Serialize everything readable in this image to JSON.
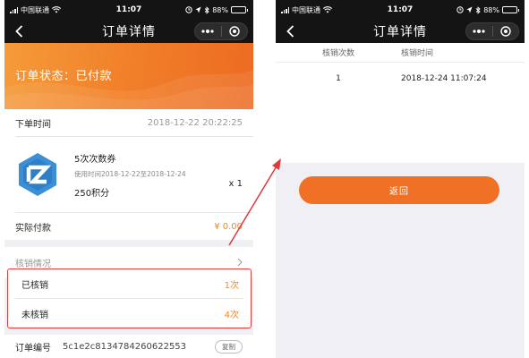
{
  "status_bar": {
    "carrier": "中国联通",
    "time": "11:07",
    "battery": "88%",
    "battery_level": 0.88
  },
  "left": {
    "nav_title": "订单详情",
    "order_status": "订单状态：已付款",
    "order_time_label": "下单时间",
    "order_time_value": "2018-12-22 20:22:25",
    "product": {
      "name": "5次次数券",
      "period": "使用时间2018-12-22至2018-12-24",
      "points": "250积分",
      "qty": "x 1"
    },
    "actual_paid_label": "实际付款",
    "actual_paid_value": "¥ 0.00",
    "redeem_section_label": "核销情况",
    "redeemed_label": "已核销",
    "redeemed_value": "1次",
    "unredeemed_label": "未核销",
    "unredeemed_value": "4次",
    "order_no_label": "订单编号",
    "order_no_value": "5c1e2c8134784260622553",
    "copy_label": "复制"
  },
  "right": {
    "nav_title": "订单详情",
    "columns": [
      "核销次数",
      "核销时间"
    ],
    "rows": [
      {
        "count": "1",
        "time": "2018-12-24 11:07:24"
      }
    ],
    "back_label": "返回"
  },
  "colors": {
    "accent": "#f07026",
    "highlight_border": "#e03a3a",
    "nav_bg": "#141414"
  },
  "icons": [
    "back-arrow-icon",
    "more-dots-icon",
    "target-close-icon",
    "chevron-right-icon",
    "wifi-icon",
    "bluetooth-icon",
    "alarm-icon",
    "coupon-logo-icon"
  ]
}
